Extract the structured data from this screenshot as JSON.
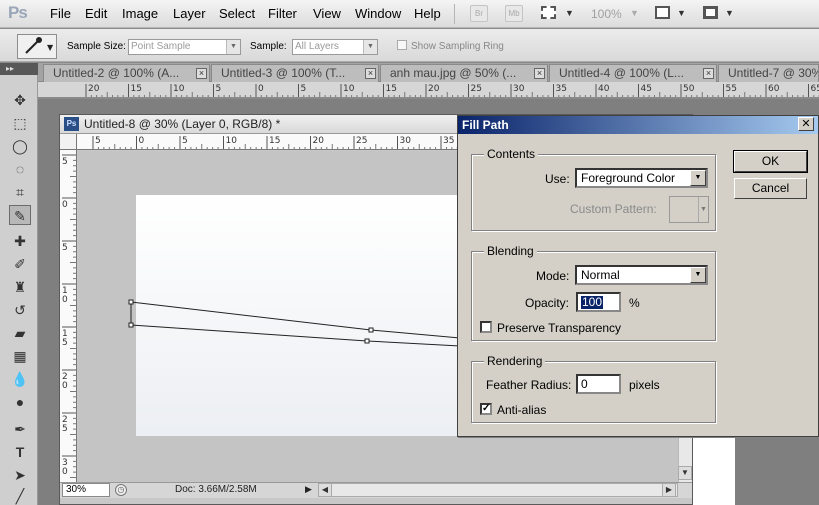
{
  "app": {
    "logo": "Ps"
  },
  "menu": {
    "items": [
      "File",
      "Edit",
      "Image",
      "Layer",
      "Select",
      "Filter",
      "View",
      "Window",
      "Help"
    ],
    "bridge_label": "Br",
    "minibridge_label": "Mb",
    "zoom": "100%"
  },
  "options": {
    "sample_size_label": "Sample Size:",
    "sample_size_value": "Point Sample",
    "sample_label": "Sample:",
    "sample_value": "All Layers",
    "show_sampling_ring_label": "Show Sampling Ring",
    "show_sampling_ring_checked": false
  },
  "tabs": [
    {
      "label": "Untitled-2 @ 100% (A..."
    },
    {
      "label": "Untitled-3 @ 100% (T..."
    },
    {
      "label": "anh mau.jpg @ 50% (..."
    },
    {
      "label": "Untitled-4 @ 100% (L..."
    },
    {
      "label": "Untitled-7 @ 30%"
    }
  ],
  "top_ruler": {
    "ticks": [
      "20",
      "15",
      "10",
      "5",
      "0",
      "5",
      "10",
      "15",
      "20",
      "25",
      "30",
      "35",
      "40",
      "45",
      "50",
      "55",
      "60",
      "65"
    ]
  },
  "document": {
    "title": "Untitled-8 @ 30% (Layer 0, RGB/8) *",
    "hruler_ticks": [
      "5",
      "0",
      "5",
      "10",
      "15",
      "20",
      "25",
      "30",
      "35"
    ],
    "vruler_ticks": [
      "5",
      "0",
      "5",
      "1\n0",
      "1\n5",
      "2\n0",
      "2\n5",
      "3\n0"
    ],
    "zoom": "30%",
    "doc_size": "Doc: 3.66M/2.58M"
  },
  "dialog": {
    "title": "Fill Path",
    "contents": {
      "group_label": "Contents",
      "use_label": "Use:",
      "use_value": "Foreground Color",
      "custom_pattern_label": "Custom Pattern:"
    },
    "blending": {
      "group_label": "Blending",
      "mode_label": "Mode:",
      "mode_value": "Normal",
      "opacity_label": "Opacity:",
      "opacity_value": "100",
      "opacity_unit": "%",
      "preserve_transparency_label": "Preserve Transparency",
      "preserve_transparency_checked": false
    },
    "rendering": {
      "group_label": "Rendering",
      "feather_radius_label": "Feather Radius:",
      "feather_radius_value": "0",
      "feather_unit": "pixels",
      "anti_alias_label": "Anti-alias",
      "anti_alias_checked": true
    },
    "ok_label": "OK",
    "cancel_label": "Cancel"
  },
  "icons": {
    "tools": [
      "move-icon",
      "marquee-icon",
      "lasso-icon",
      "quick-selection-icon",
      "crop-icon",
      "eyedropper-icon",
      "healing-brush-icon",
      "brush-icon",
      "clone-stamp-icon",
      "history-brush-icon",
      "eraser-icon",
      "gradient-icon",
      "blur-icon",
      "dodge-icon",
      "pen-icon",
      "type-icon",
      "path-selection-icon",
      "line-icon"
    ]
  }
}
